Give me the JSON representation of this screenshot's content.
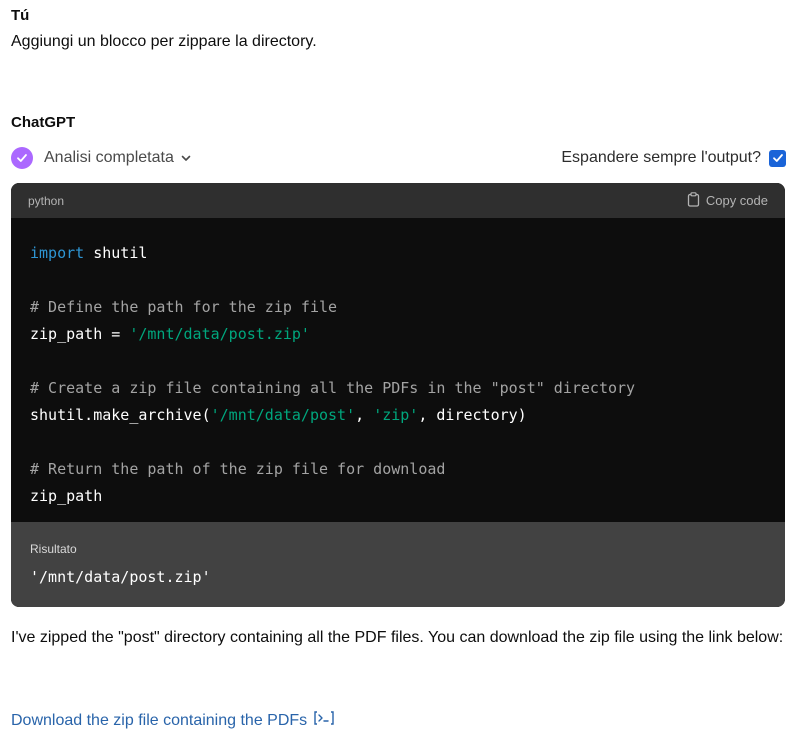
{
  "user": {
    "name": "Tú",
    "message": "Aggiungi un blocco per zippare la directory."
  },
  "assistant": {
    "name": "ChatGPT",
    "status": "Analisi completata",
    "expand_label": "Espandere sempre l'output?",
    "expand_checked": true,
    "status_icon": "check-circle-icon",
    "accent_color": "#ab68ff",
    "code_block": {
      "language": "python",
      "copy_label": "Copy code",
      "lines": {
        "l1_kw": "import",
        "l1_rest": " shutil",
        "l3": "# Define the path for the zip file",
        "l4_a": "zip_path = ",
        "l4_str": "'/mnt/data/post.zip'",
        "l6": "# Create a zip file containing all the PDFs in the \"post\" directory",
        "l7_a": "shutil.make_archive(",
        "l7_s1": "'/mnt/data/post'",
        "l7_b": ", ",
        "l7_s2": "'zip'",
        "l7_c": ", directory)",
        "l9": "# Return the path of the zip file for download",
        "l10": "zip_path"
      },
      "result_label": "Risultato",
      "result_value": "'/mnt/data/post.zip'"
    },
    "reply": "I've zipped the \"post\" directory containing all the PDF files. You can download the zip file using the link below:",
    "download_link": "Download the zip file containing the PDFs",
    "link_color": "#2964aa"
  }
}
